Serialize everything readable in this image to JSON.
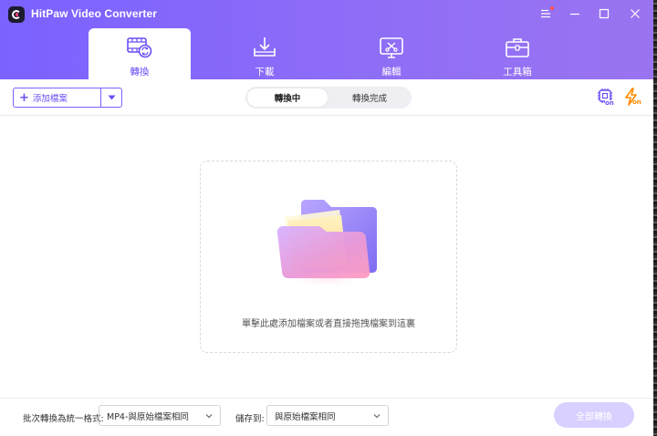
{
  "app": {
    "title": "HitPaw Video Converter"
  },
  "window_controls": {
    "menu_icon": "hamburger-menu-icon",
    "minimize_icon": "minimize-icon",
    "maximize_icon": "maximize-icon",
    "close_icon": "close-icon"
  },
  "tabs": [
    {
      "label": "轉換",
      "icon": "film-convert-icon",
      "active": true
    },
    {
      "label": "下載",
      "icon": "download-tray-icon",
      "active": false
    },
    {
      "label": "編輯",
      "icon": "edit-screen-icon",
      "active": false
    },
    {
      "label": "工具箱",
      "icon": "toolbox-icon",
      "active": false
    }
  ],
  "toolbar": {
    "add_label": "添加檔案",
    "segments": [
      "轉換中",
      "轉換完成"
    ],
    "hardware_badge": "on",
    "speed_badge": "on"
  },
  "dropzone": {
    "hint": "單擊此處添加檔案或者直接拖拽檔案到這裏"
  },
  "footer": {
    "format_label": "批次轉換為統一格式:",
    "format_value": "MP4-與原始檔案相同",
    "save_label": "儲存到:",
    "save_value": "與原始檔案相同",
    "convert_all": "全部轉換"
  },
  "colors": {
    "accent": "#7b61ff",
    "header_start": "#7b61ff",
    "header_end": "#9a74f0",
    "disabled_button": "#d9d0ff",
    "speed_icon": "#ff8a00"
  }
}
